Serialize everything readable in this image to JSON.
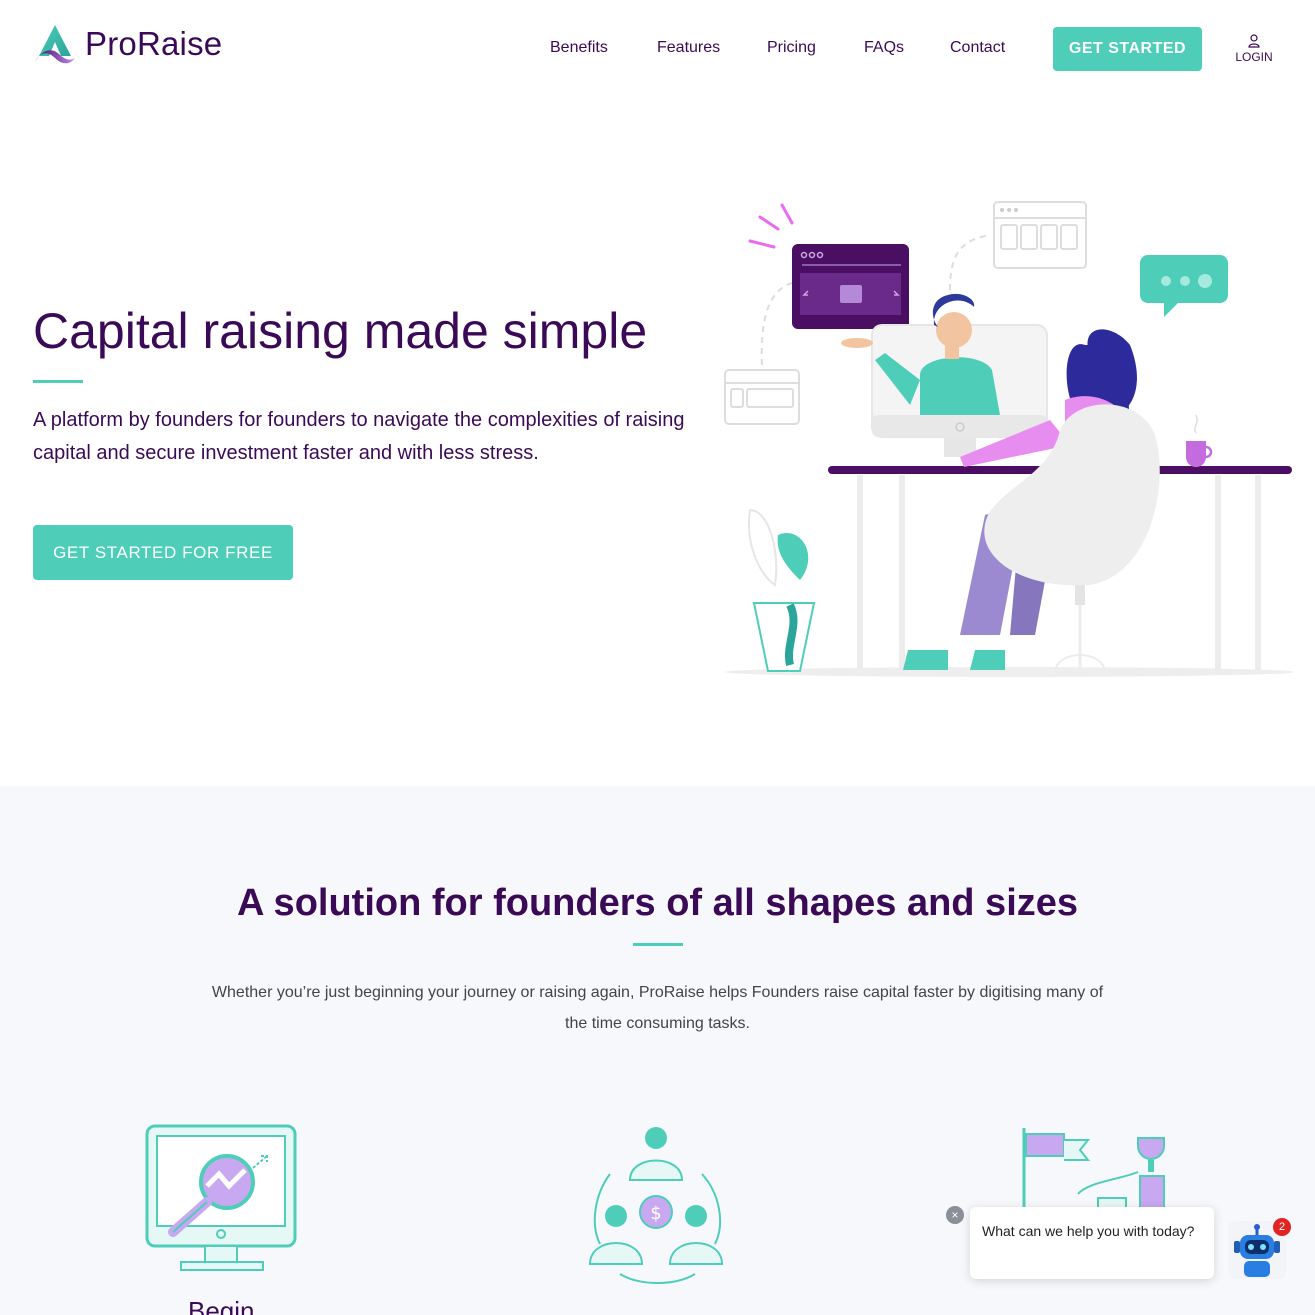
{
  "brand": {
    "name": "ProRaise",
    "accent": "#4ecdb9",
    "primary": "#3b0a57"
  },
  "nav": {
    "items": [
      {
        "label": "Benefits"
      },
      {
        "label": "Features"
      },
      {
        "label": "Pricing"
      },
      {
        "label": "FAQs"
      },
      {
        "label": "Contact"
      }
    ],
    "cta_label": "GET STARTED",
    "login_label": "LOGIN",
    "login_icon": "user-icon"
  },
  "hero": {
    "title": "Capital raising made simple",
    "subtitle": "A platform by founders for founders to navigate the complexities of raising capital and secure investment faster and with less stress.",
    "cta_label": "GET STARTED FOR FREE"
  },
  "solutions": {
    "title": "A solution for founders of all shapes and sizes",
    "subtitle": "Whether you’re just beginning your journey or raising again, ProRaise helps Founders raise capital faster by digitising many of the time consuming tasks.",
    "features": [
      {
        "label": "Begin",
        "icon": "monitor-search-icon"
      },
      {
        "label": "",
        "icon": "investors-network-icon"
      },
      {
        "label": "",
        "icon": "goals-trophy-icon"
      }
    ]
  },
  "chat": {
    "message": "What can we help you with today?",
    "badge_count": "2",
    "close_icon": "close-icon",
    "avatar_icon": "robot-icon"
  }
}
